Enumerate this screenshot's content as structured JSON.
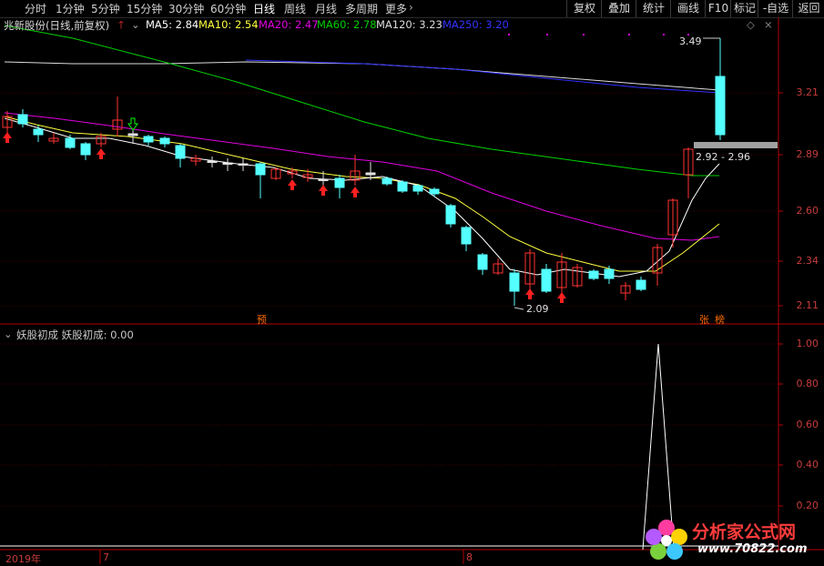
{
  "toolbar": {
    "periods": [
      "分时",
      "1分钟",
      "5分钟",
      "15分钟",
      "30分钟",
      "60分钟",
      "日线",
      "周线",
      "月线",
      "多周期",
      "更多"
    ],
    "active_period": "日线",
    "right_buttons": [
      "复权",
      "叠加",
      "统计",
      "画线",
      "F10",
      "标记",
      "-自选",
      "返回"
    ]
  },
  "legend": {
    "stock": "兆新股份(日线,前复权)",
    "ma5": "MA5: 2.84",
    "ma10": "MA10: 2.54",
    "ma20": "MA20: 2.47",
    "ma60": "MA60: 2.78",
    "ma120": "MA120: 3.23",
    "ma250": "MA250: 3.20",
    "colors": {
      "ma5": "#ffffff",
      "ma10": "#ffff00",
      "ma20": "#ff00ff",
      "ma60": "#00e000",
      "ma120": "#e0e0e0",
      "ma250": "#3030ff"
    }
  },
  "annotations": {
    "high": "3.49",
    "low": "2.09",
    "range": "2.92 - 2.96",
    "tag_yu": "预",
    "tag_zhang": "张",
    "tag_bang": "榜"
  },
  "price_axis": [
    "3.21",
    "2.89",
    "2.60",
    "2.34",
    "2.11"
  ],
  "indicator": {
    "legend": "妖股初成  妖股初成: 0.00",
    "axis": [
      "1.00",
      "0.80",
      "0.60",
      "0.40",
      "0.20"
    ]
  },
  "dates": {
    "year": "2019年",
    "m7": "7",
    "m8": "8"
  },
  "watermark": {
    "brand": "分析家公式网",
    "url": "www.70822.com"
  },
  "colors": {
    "up": "#ff3232",
    "down": "#54ffff",
    "axis": "#b40000",
    "bg": "#000000"
  }
}
